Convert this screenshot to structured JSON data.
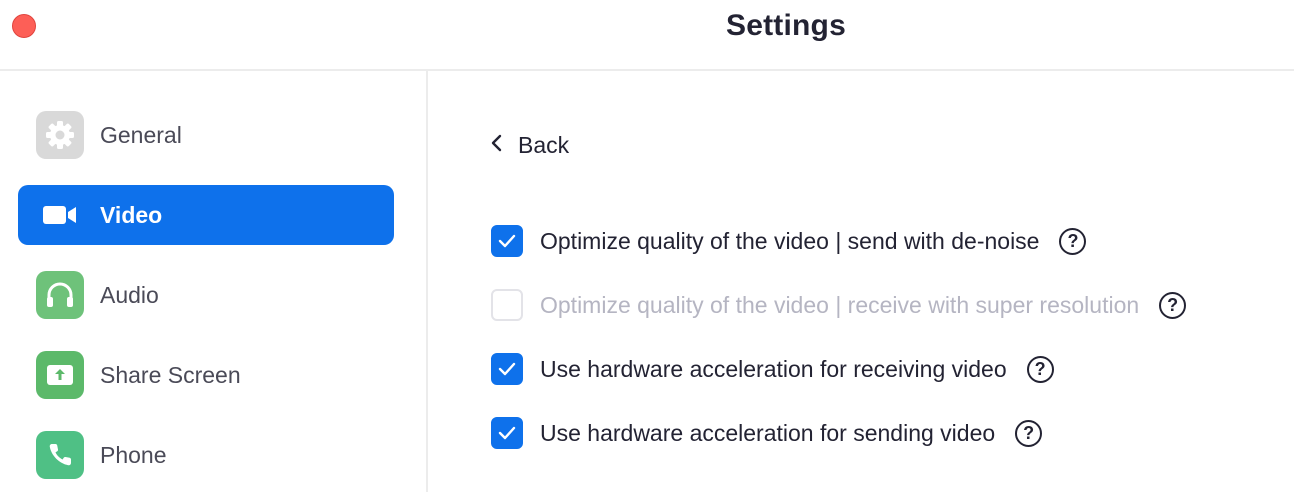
{
  "window": {
    "title": "Settings"
  },
  "sidebar": {
    "items": [
      {
        "label": "General",
        "icon": "gear-icon",
        "color": "#d9d9d9",
        "active": false
      },
      {
        "label": "Video",
        "icon": "video-camera-icon",
        "color": "#0e71eb",
        "active": true
      },
      {
        "label": "Audio",
        "icon": "headphones-icon",
        "color": "#6ec27a",
        "active": false
      },
      {
        "label": "Share Screen",
        "icon": "share-screen-icon",
        "color": "#5cb96a",
        "active": false
      },
      {
        "label": "Phone",
        "icon": "phone-icon",
        "color": "#4fc085",
        "active": false
      }
    ]
  },
  "main": {
    "back_label": "Back",
    "options": [
      {
        "label": "Optimize quality of the video | send with de-noise",
        "checked": true,
        "disabled": false
      },
      {
        "label": "Optimize quality of the video | receive with super resolution",
        "checked": false,
        "disabled": true
      },
      {
        "label": "Use hardware acceleration for receiving video",
        "checked": true,
        "disabled": false
      },
      {
        "label": "Use hardware acceleration for sending video",
        "checked": true,
        "disabled": false
      }
    ],
    "help_glyph": "?"
  },
  "colors": {
    "accent": "#0e71eb",
    "close_button": "#fd5f57",
    "text": "#232333",
    "disabled_text": "#b5b5c2"
  }
}
